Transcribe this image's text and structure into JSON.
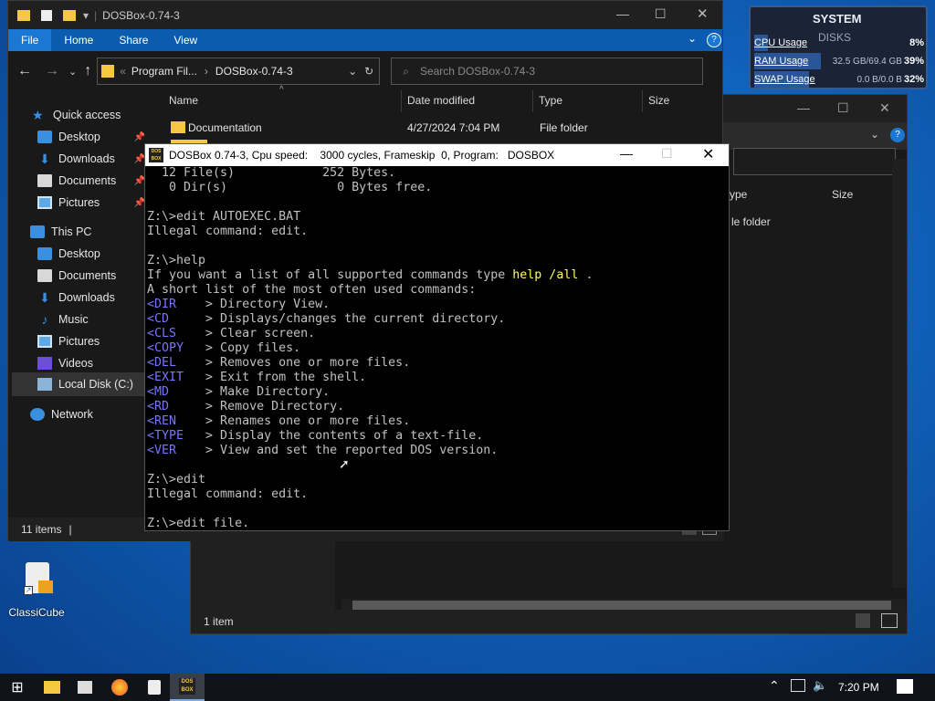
{
  "widget": {
    "title": "SYSTEM",
    "subtitle": "DISKS",
    "cpu": {
      "label": "CPU Usage",
      "value": "8%",
      "fill": 0.08
    },
    "ram": {
      "label": "RAM Usage",
      "detail": "32.5 GB/69.4 GB",
      "value": "39%",
      "fill": 0.39
    },
    "swap": {
      "label": "SWAP Usage",
      "detail": "0.0 B/0.0 B",
      "value": "32%",
      "fill": 0.32
    }
  },
  "explorer": {
    "title": "DOSBox-0.74-3",
    "ribbon": [
      "File",
      "Home",
      "Share",
      "View"
    ],
    "breadcrumb": {
      "root": "Program Fil...",
      "current": "DOSBox-0.74-3"
    },
    "search_placeholder": "Search DOSBox-0.74-3",
    "columns": {
      "name": "Name",
      "date": "Date modified",
      "type": "Type",
      "size": "Size"
    },
    "rows": [
      {
        "name": "Documentation",
        "date": "4/27/2024 7:04 PM",
        "type": "File folder"
      }
    ],
    "nav": {
      "quick_access": "Quick access",
      "this_pc": "This PC",
      "network": "Network",
      "quick": [
        "Desktop",
        "Downloads",
        "Documents",
        "Pictures"
      ],
      "pc": [
        "Desktop",
        "Documents",
        "Downloads",
        "Music",
        "Pictures",
        "Videos",
        "Local Disk (C:)"
      ]
    },
    "status": "11 items"
  },
  "bg_explorer": {
    "col_type": "ype",
    "col_size": "Size",
    "row_type": "le folder",
    "status": "1 item"
  },
  "dosbox": {
    "title": "DOSBox 0.74-3, Cpu speed:    3000 cycles, Frameskip  0, Program:   DOSBOX",
    "logo": "DOS BOX",
    "lines": {
      "l1": "  12 File(s)            252 Bytes.",
      "l2": "   0 Dir(s)               0 Bytes free.",
      "l3": "",
      "l4": "Z:\\>edit AUTOEXEC.BAT",
      "l5": "Illegal command: edit.",
      "l6": "",
      "l7": "Z:\\>help",
      "l8a": "If you want a list of all supported commands type ",
      "l8b": "help /all",
      "l8c": " .",
      "l9": "A short list of the most often used commands:",
      "cmds": [
        {
          "c": "<DIR    ",
          "d": "> Directory View."
        },
        {
          "c": "<CD     ",
          "d": "> Displays/changes the current directory."
        },
        {
          "c": "<CLS    ",
          "d": "> Clear screen."
        },
        {
          "c": "<COPY   ",
          "d": "> Copy files."
        },
        {
          "c": "<DEL    ",
          "d": "> Removes one or more files."
        },
        {
          "c": "<EXIT   ",
          "d": "> Exit from the shell."
        },
        {
          "c": "<MD     ",
          "d": "> Make Directory."
        },
        {
          "c": "<RD     ",
          "d": "> Remove Directory."
        },
        {
          "c": "<REN    ",
          "d": "> Renames one or more files."
        },
        {
          "c": "<TYPE   ",
          "d": "> Display the contents of a text-file."
        },
        {
          "c": "<VER    ",
          "d": "> View and set the reported DOS version."
        }
      ],
      "l10": "",
      "l11": "Z:\\>edit",
      "l12": "Illegal command: edit.",
      "l13": "",
      "l14": "Z:\\>edit file."
    }
  },
  "desktop": {
    "icon_label": "ClassiCube"
  },
  "taskbar": {
    "time": "7:20 PM",
    "dosbox_label": "DOS BOX"
  },
  "colors": {
    "accent": "#0b5cae",
    "dos_yellow": "#ffff55",
    "dos_blue": "#7777ff"
  }
}
